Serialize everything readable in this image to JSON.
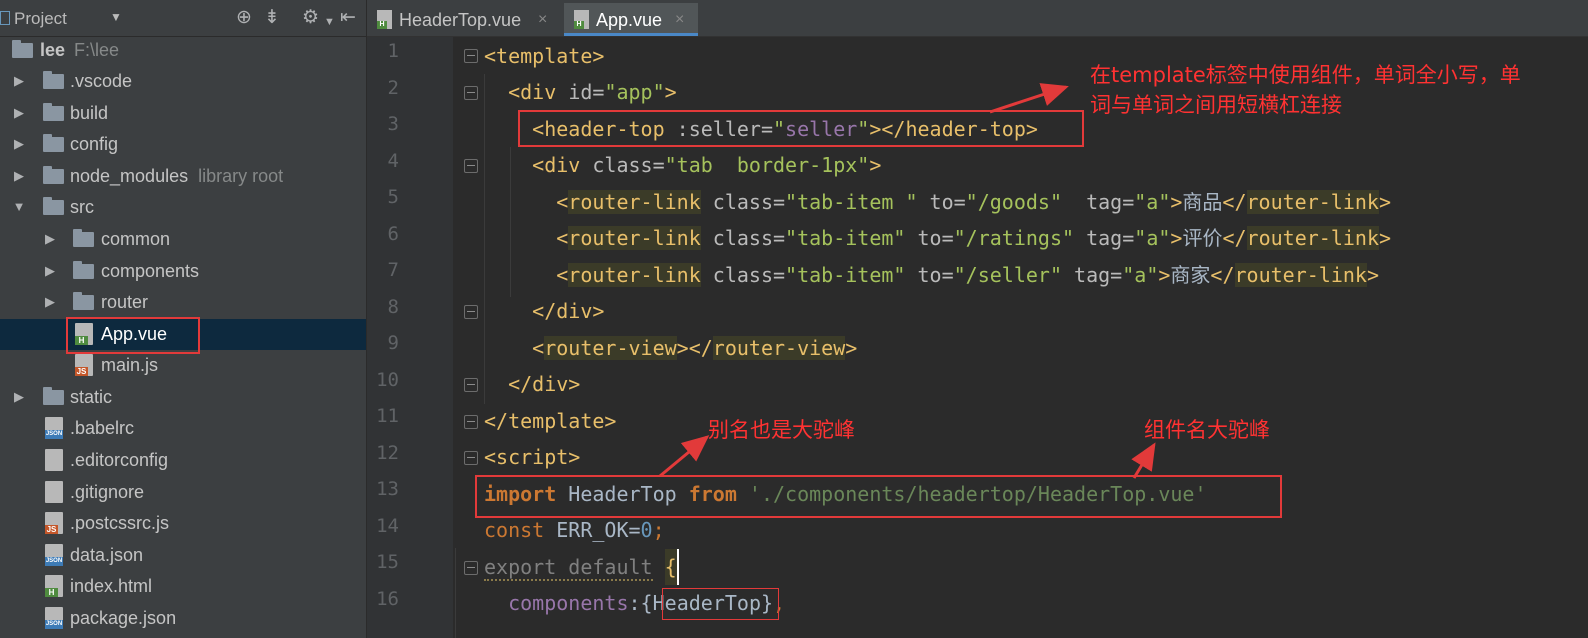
{
  "project_panel": {
    "title": "Project",
    "root": {
      "name": "lee",
      "path": "F:\\lee"
    },
    "items": [
      {
        "label": ".vscode",
        "note": ""
      },
      {
        "label": "build",
        "note": ""
      },
      {
        "label": "config",
        "note": ""
      },
      {
        "label": "node_modules",
        "note": "library root"
      },
      {
        "label": "src",
        "note": ""
      },
      {
        "label": "common",
        "note": ""
      },
      {
        "label": "components",
        "note": ""
      },
      {
        "label": "router",
        "note": ""
      },
      {
        "label": "App.vue",
        "note": ""
      },
      {
        "label": "main.js",
        "note": ""
      },
      {
        "label": "static",
        "note": ""
      },
      {
        "label": ".babelrc",
        "note": ""
      },
      {
        "label": ".editorconfig",
        "note": ""
      },
      {
        "label": ".gitignore",
        "note": ""
      },
      {
        "label": ".postcssrc.js",
        "note": ""
      },
      {
        "label": "data.json",
        "note": ""
      },
      {
        "label": "index.html",
        "note": ""
      },
      {
        "label": "package.json",
        "note": ""
      }
    ],
    "icon_tags": {
      "html": "H",
      "js": "JS",
      "json": "JSON"
    }
  },
  "tabs": [
    {
      "label": "HeaderTop.vue",
      "close": "×"
    },
    {
      "label": "App.vue",
      "close": "×"
    }
  ],
  "line_numbers": [
    "1",
    "2",
    "3",
    "4",
    "5",
    "6",
    "7",
    "8",
    "9",
    "10",
    "11",
    "12",
    "13",
    "14",
    "15",
    "16"
  ],
  "code": {
    "l1": {
      "t1": "<template>"
    },
    "l2": {
      "t1": "<div ",
      "a1": "id=",
      "v1": "\"app\"",
      "t2": ">"
    },
    "l3": {
      "t1": "<header-top ",
      "a1": ":seller=",
      "q1": "\"",
      "v1": "seller",
      "q2": "\"",
      "t2": "></header-top>"
    },
    "l4": {
      "t1": "<div ",
      "a1": "class=",
      "v1": "\"tab  border-1px\"",
      "t2": ">"
    },
    "l5": {
      "t1": "<",
      "tn": "router-link",
      "a1": " class=",
      "v1": "\"tab-item \"",
      "a2": " to=",
      "v2": "\"/goods\"",
      "a3": "  tag=",
      "v3": "\"a\"",
      "t2": ">",
      "txt": "商品",
      "t3": "</",
      "tn2": "router-link",
      "t4": ">"
    },
    "l6": {
      "t1": "<",
      "tn": "router-link",
      "a1": " class=",
      "v1": "\"tab-item\"",
      "a2": " to=",
      "v2": "\"/ratings\"",
      "a3": " tag=",
      "v3": "\"a\"",
      "t2": ">",
      "txt": "评价",
      "t3": "</",
      "tn2": "router-link",
      "t4": ">"
    },
    "l7": {
      "t1": "<",
      "tn": "router-link",
      "a1": " class=",
      "v1": "\"tab-item\"",
      "a2": " to=",
      "v2": "\"/seller\"",
      "a3": " tag=",
      "v3": "\"a\"",
      "t2": ">",
      "txt": "商家",
      "t3": "</",
      "tn2": "router-link",
      "t4": ">"
    },
    "l8": {
      "t1": "</div>"
    },
    "l9": {
      "t1": "<",
      "tn": "router-view",
      "t2": "></",
      "tn2": "router-view",
      "t3": ">"
    },
    "l10": {
      "t1": "</div>"
    },
    "l11": {
      "t1": "</template>"
    },
    "l12": {
      "t1": "<script>"
    },
    "l13": {
      "k1": "import",
      "p1": " HeaderTop ",
      "k2": "from",
      "sp": " ",
      "s1": "'./components/headertop/HeaderTop.vue'"
    },
    "l14": {
      "k1": "const",
      "p1": " ERR_OK=",
      "n1": "0",
      "e": ";"
    },
    "l15": {
      "k1": "export default",
      "sp": " ",
      "b1": "{"
    },
    "l16": {
      "f1": "components",
      "p1": ":{",
      "p2": "HeaderTop",
      "p3": "}",
      "e": ","
    }
  },
  "annotations": {
    "note1_line1": "在template标签中使用组件，单词全小写，单",
    "note1_line2": "词与单词之间用短横杠连接",
    "note2": "别名也是大驼峰",
    "note3": "组件名大驼峰",
    "color": "#e23a3a"
  }
}
